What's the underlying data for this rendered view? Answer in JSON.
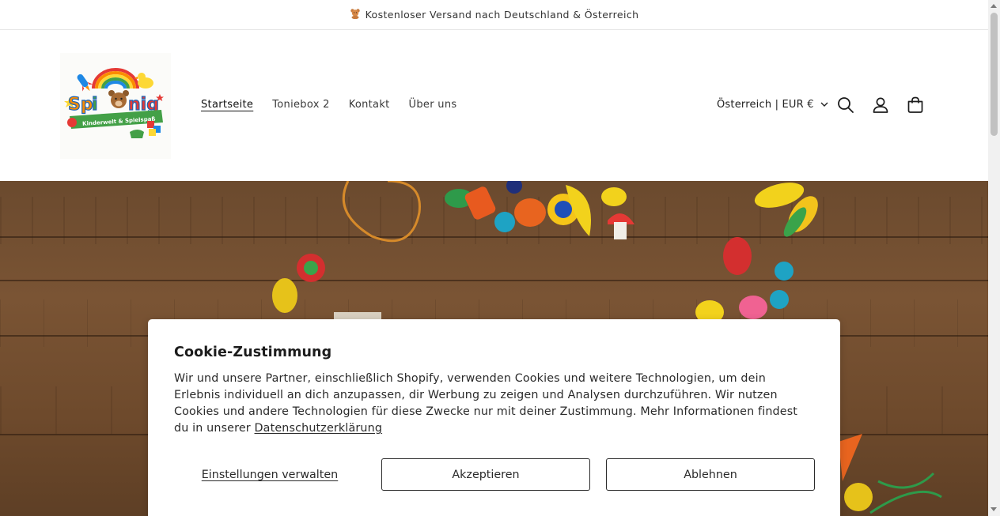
{
  "announcement": {
    "icon": "teddy-bear-icon",
    "text": "Kostenloser Versand nach Deutschland & Österreich"
  },
  "header": {
    "logo": {
      "name": "Spikönig",
      "tagline": "Kinderwelt & Spielspaß"
    },
    "nav": [
      {
        "label": "Startseite",
        "active": true
      },
      {
        "label": "Toniebox 2",
        "active": false
      },
      {
        "label": "Kontakt",
        "active": false
      },
      {
        "label": "Über uns",
        "active": false
      }
    ],
    "locale": {
      "label": "Österreich | EUR €"
    },
    "icons": [
      "search-icon",
      "account-icon",
      "cart-icon"
    ]
  },
  "cookie_banner": {
    "title": "Cookie-Zustimmung",
    "body": "Wir und unsere Partner, einschließlich Shopify, verwenden Cookies und weitere Technologien, um dein Erlebnis individuell an dich anzupassen, dir Werbung zu zeigen und Analysen durchzuführen. Wir nutzen Cookies und andere Technologien für diese Zwecke nur mit deiner Zustimmung. Mehr Informationen findest du in unserer ",
    "privacy_link": "Datenschutzerklärung",
    "manage_label": "Einstellungen verwalten",
    "accept_label": "Akzeptieren",
    "decline_label": "Ablehnen"
  },
  "colors": {
    "accent": "#121212",
    "hero_wood": "#6b4a2e",
    "page_bg": "#ffffff"
  }
}
